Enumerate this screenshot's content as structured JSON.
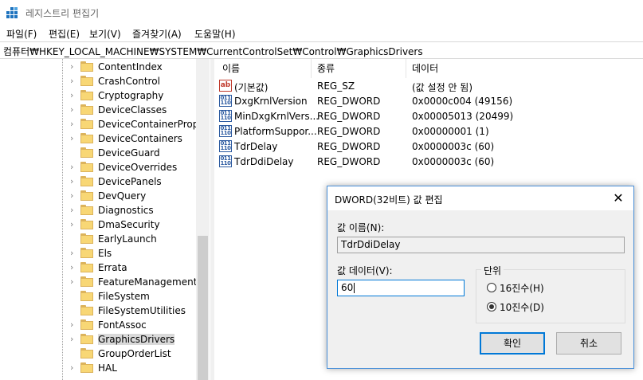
{
  "window": {
    "title": "레지스트리 편집기"
  },
  "menu": [
    "파일(F)",
    "편집(E)",
    "보기(V)",
    "즐겨찾기(A)",
    "도움말(H)"
  ],
  "address": "컴퓨터₩HKEY_LOCAL_MACHINE₩SYSTEM₩CurrentControlSet₩Control₩GraphicsDrivers",
  "tree": {
    "items": [
      {
        "label": "ContentIndex",
        "expandable": true
      },
      {
        "label": "CrashControl",
        "expandable": true
      },
      {
        "label": "Cryptography",
        "expandable": true
      },
      {
        "label": "DeviceClasses",
        "expandable": true
      },
      {
        "label": "DeviceContainerProper",
        "expandable": true
      },
      {
        "label": "DeviceContainers",
        "expandable": true
      },
      {
        "label": "DeviceGuard",
        "expandable": false
      },
      {
        "label": "DeviceOverrides",
        "expandable": true
      },
      {
        "label": "DevicePanels",
        "expandable": true
      },
      {
        "label": "DevQuery",
        "expandable": true
      },
      {
        "label": "Diagnostics",
        "expandable": true
      },
      {
        "label": "DmaSecurity",
        "expandable": true
      },
      {
        "label": "EarlyLaunch",
        "expandable": false
      },
      {
        "label": "Els",
        "expandable": true
      },
      {
        "label": "Errata",
        "expandable": true
      },
      {
        "label": "FeatureManagement",
        "expandable": true
      },
      {
        "label": "FileSystem",
        "expandable": false
      },
      {
        "label": "FileSystemUtilities",
        "expandable": false
      },
      {
        "label": "FontAssoc",
        "expandable": true
      },
      {
        "label": "GraphicsDrivers",
        "expandable": true,
        "selected": true
      },
      {
        "label": "GroupOrderList",
        "expandable": false
      },
      {
        "label": "HAL",
        "expandable": true
      }
    ]
  },
  "list": {
    "columns": [
      "이름",
      "종류",
      "데이터"
    ],
    "rows": [
      {
        "icon": "string-value-icon",
        "name": "(기본값)",
        "type": "REG_SZ",
        "data": "(값 설정 안 됨)"
      },
      {
        "icon": "binary-value-icon",
        "name": "DxgKrnlVersion",
        "type": "REG_DWORD",
        "data": "0x0000c004 (49156)"
      },
      {
        "icon": "binary-value-icon",
        "name": "MinDxgKrnlVers...",
        "type": "REG_DWORD",
        "data": "0x00005013 (20499)"
      },
      {
        "icon": "binary-value-icon",
        "name": "PlatformSuppor...",
        "type": "REG_DWORD",
        "data": "0x00000001 (1)"
      },
      {
        "icon": "binary-value-icon",
        "name": "TdrDelay",
        "type": "REG_DWORD",
        "data": "0x0000003c (60)"
      },
      {
        "icon": "binary-value-icon",
        "name": "TdrDdiDelay",
        "type": "REG_DWORD",
        "data": "0x0000003c (60)"
      }
    ]
  },
  "dialog": {
    "title": "DWORD(32비트) 값 편집",
    "name_label": "값 이름(N):",
    "name_value": "TdrDdiDelay",
    "data_label": "값 데이터(V):",
    "data_value": "60",
    "base_group": "단위",
    "radio_hex": "16진수(H)",
    "radio_dec": "10진수(D)",
    "selected_base": "dec",
    "ok": "확인",
    "cancel": "취소"
  }
}
